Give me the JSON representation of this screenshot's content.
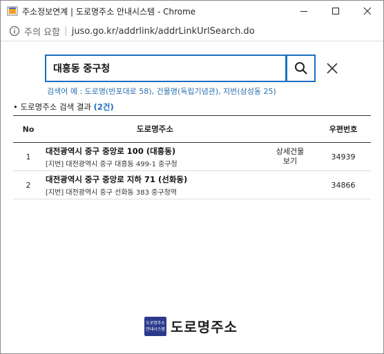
{
  "window": {
    "title": "주소정보연계 | 도로명주소 안내시스템 - Chrome",
    "security_label": "주의 요함",
    "url": "juso.go.kr/addrlink/addrLinkUrlSearch.do"
  },
  "search": {
    "value": "대흥동 중구청",
    "example": "검색어 예 : 도로명(반포대로 58), 건물명(독립기념관), 지번(삼성동 25)"
  },
  "results": {
    "prefix": "도로명주소 검색 결과",
    "count": "(2건)",
    "headers": {
      "no": "No",
      "addr": "도로명주소",
      "zip": "우편번호"
    },
    "rows": [
      {
        "no": "1",
        "road": "대전광역시 중구 중앙로 100 (대흥동)",
        "jibun": "[지번] 대전광역시 중구 대흥동 499-1 중구청",
        "detail_line1": "상세건물",
        "detail_line2": "보기",
        "zip": "34939"
      },
      {
        "no": "2",
        "road": "대전광역시 중구 중앙로 지하 71 (선화동)",
        "jibun": "[지번] 대전광역시 중구 선화동 383 중구청역",
        "detail_line1": "",
        "detail_line2": "",
        "zip": "34866"
      }
    ]
  },
  "logo": {
    "badge_line1": "도로명주소",
    "badge_line2": "안내시스템",
    "text": "도로명주소"
  },
  "colors": {
    "accent": "#1a6ec1",
    "example_text": "#2a6fb0",
    "logo_badge": "#2b3a8c"
  }
}
